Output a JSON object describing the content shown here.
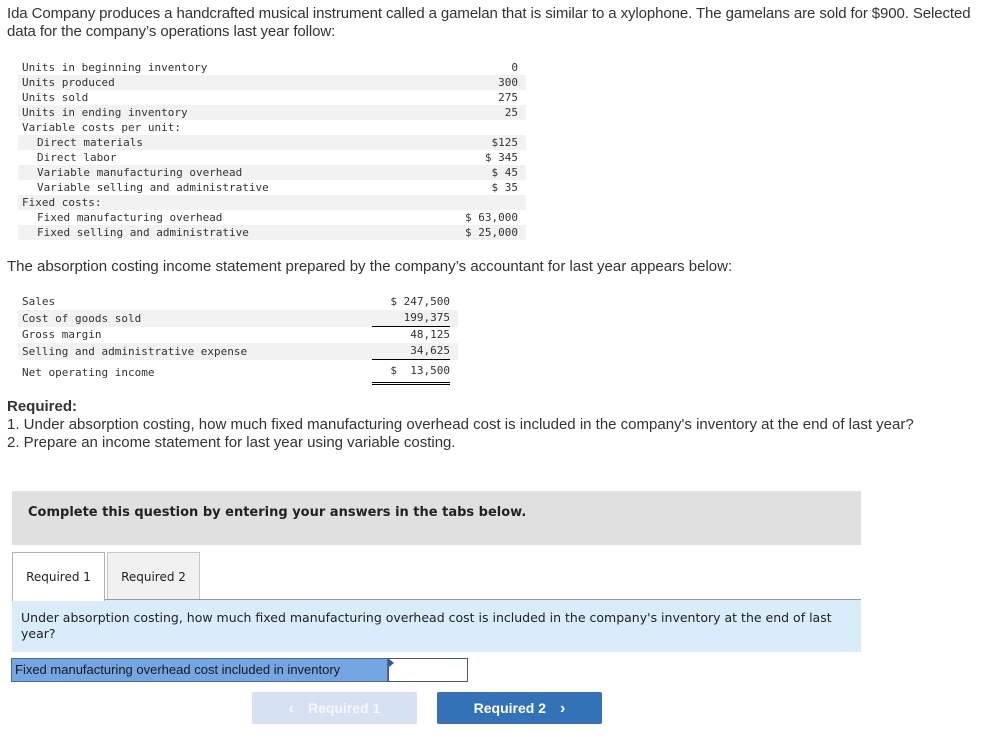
{
  "intro": "Ida Company produces a handcrafted musical instrument called a gamelan that is similar to a xylophone. The gamelans are sold for $900. Selected data for the company’s operations last year follow:",
  "data_table": {
    "rows": [
      {
        "label": "Units in beginning inventory",
        "value": "0",
        "indent": false
      },
      {
        "label": "Units produced",
        "value": "300",
        "indent": false
      },
      {
        "label": "Units sold",
        "value": "275",
        "indent": false
      },
      {
        "label": "Units in ending inventory",
        "value": "25",
        "indent": false
      },
      {
        "label": "Variable costs per unit:",
        "value": "",
        "indent": false
      },
      {
        "label": "Direct materials",
        "value": "$125",
        "indent": true
      },
      {
        "label": "Direct labor",
        "value": "$ 345",
        "indent": true
      },
      {
        "label": "Variable manufacturing overhead",
        "value": "$ 45",
        "indent": true
      },
      {
        "label": "Variable selling and administrative",
        "value": "$ 35",
        "indent": true
      },
      {
        "label": "Fixed costs:",
        "value": "",
        "indent": false
      },
      {
        "label": "Fixed manufacturing overhead",
        "value": "$ 63,000",
        "indent": true
      },
      {
        "label": "Fixed selling and administrative",
        "value": "$ 25,000",
        "indent": true
      }
    ]
  },
  "para2": "The absorption costing income statement prepared by the company’s accountant for last year appears below:",
  "income_statement": {
    "rows": [
      {
        "label": "Sales",
        "value": "$ 247,500"
      },
      {
        "label": "Cost of goods sold",
        "value": "199,375"
      },
      {
        "label": "Gross margin",
        "value": "48,125"
      },
      {
        "label": "Selling and administrative expense",
        "value": "34,625"
      },
      {
        "label": "Net operating income",
        "value": "$  13,500"
      }
    ]
  },
  "required": {
    "title": "Required:",
    "items": [
      "1. Under absorption costing, how much fixed manufacturing overhead cost is included in the company's inventory at the end of last year?",
      "2. Prepare an income statement for last year using variable costing."
    ]
  },
  "banner": "Complete this question by entering your answers in the tabs below.",
  "tabs": [
    {
      "label": "Required 1",
      "active": true
    },
    {
      "label": "Required 2",
      "active": false
    }
  ],
  "question": "Under absorption costing, how much fixed manufacturing overhead cost is included in the company's inventory at the end of last year?",
  "answer": {
    "label": "Fixed manufacturing overhead cost included in inventory",
    "value": "",
    "placeholder": ""
  },
  "nav": {
    "prev_label": "Required 1",
    "prev_icon": "‹",
    "next_label": "Required 2",
    "next_icon": "›"
  },
  "colors": {
    "accent": "#3472b8",
    "answer_label_bg": "#74a6e4",
    "question_bg": "#d9ecfa",
    "banner_bg": "#e0e0e0"
  }
}
